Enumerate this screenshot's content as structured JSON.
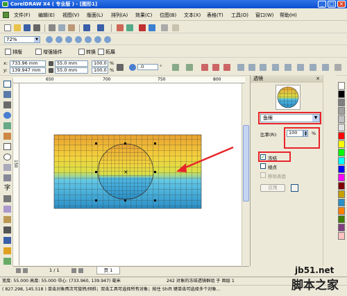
{
  "window": {
    "title": "CorelDRAW X4 ( 专业版 ) - [图形1]",
    "minimize": "_",
    "maximize": "□",
    "close": "×"
  },
  "menu": {
    "items": [
      "文件(F)",
      "编辑(E)",
      "视图(V)",
      "版面(L)",
      "排列(A)",
      "效果(C)",
      "位图(B)",
      "文本(X)",
      "表格(T)",
      "工具(O)",
      "窗口(W)",
      "帮助(H)"
    ]
  },
  "toolbar": {
    "zoom": "72%"
  },
  "plugins": {
    "tabs": [
      "排版",
      "增强插件",
      "转换",
      "拓展"
    ]
  },
  "propbar": {
    "x_label": "x:",
    "x": "733.96 mm",
    "y_label": "y:",
    "y": "139.947 mm",
    "width": "55.0 mm",
    "height": "55.0 mm",
    "scale_w": "100.0",
    "scale_h": "100.0",
    "percent": "%",
    "angle": ".0",
    "degree": "°"
  },
  "ruler": {
    "ticks": [
      "650",
      "700",
      "750",
      "800"
    ],
    "vticks": [
      "150"
    ]
  },
  "docker": {
    "title": "透镜",
    "lens_type": "鱼眼",
    "rate_label": "比率(R):",
    "rate_value": "100",
    "rate_unit": "%",
    "freeze_label": "冻结",
    "freeze_checked": true,
    "viewpoint_label": "视点",
    "remove_face_label": "移除表面",
    "apply_button": "应用"
  },
  "colors": {
    "accent_red": "#e8242b",
    "gradient": [
      "#e49a2a",
      "#f2cf3a",
      "#d4e04a",
      "#49bfe6",
      "#2a8fc7"
    ]
  },
  "palette": [
    "#ffffff",
    "#000000",
    "#808080",
    "#a0a0a0",
    "#c0c0c0",
    "#e0e0e0",
    "#ff0000",
    "#ffff00",
    "#00ff00",
    "#00ffff",
    "#0000ff",
    "#ff00ff",
    "#800000",
    "#c8a000",
    "#2a8fc7",
    "#ff8000",
    "#408000",
    "#804080",
    "#ffc0c0"
  ],
  "pagebar": {
    "page_count": "1 / 1",
    "page_tab": "页 1"
  },
  "status": {
    "line1_left": "宽度: 55.000 高度: 55.000 中心: (733.960, 139.947) 毫米",
    "line1_right": "242 对象的冻结透镜群组 于 图层 1",
    "line2": "( 827.298, 145.518 )   单击对象两次可旋转/倾斜；双击工具可选择所有对象；按住 Shift 键单击可选择多个对象..."
  },
  "watermark": {
    "site": "jb51.net",
    "name": "脚本之家"
  }
}
